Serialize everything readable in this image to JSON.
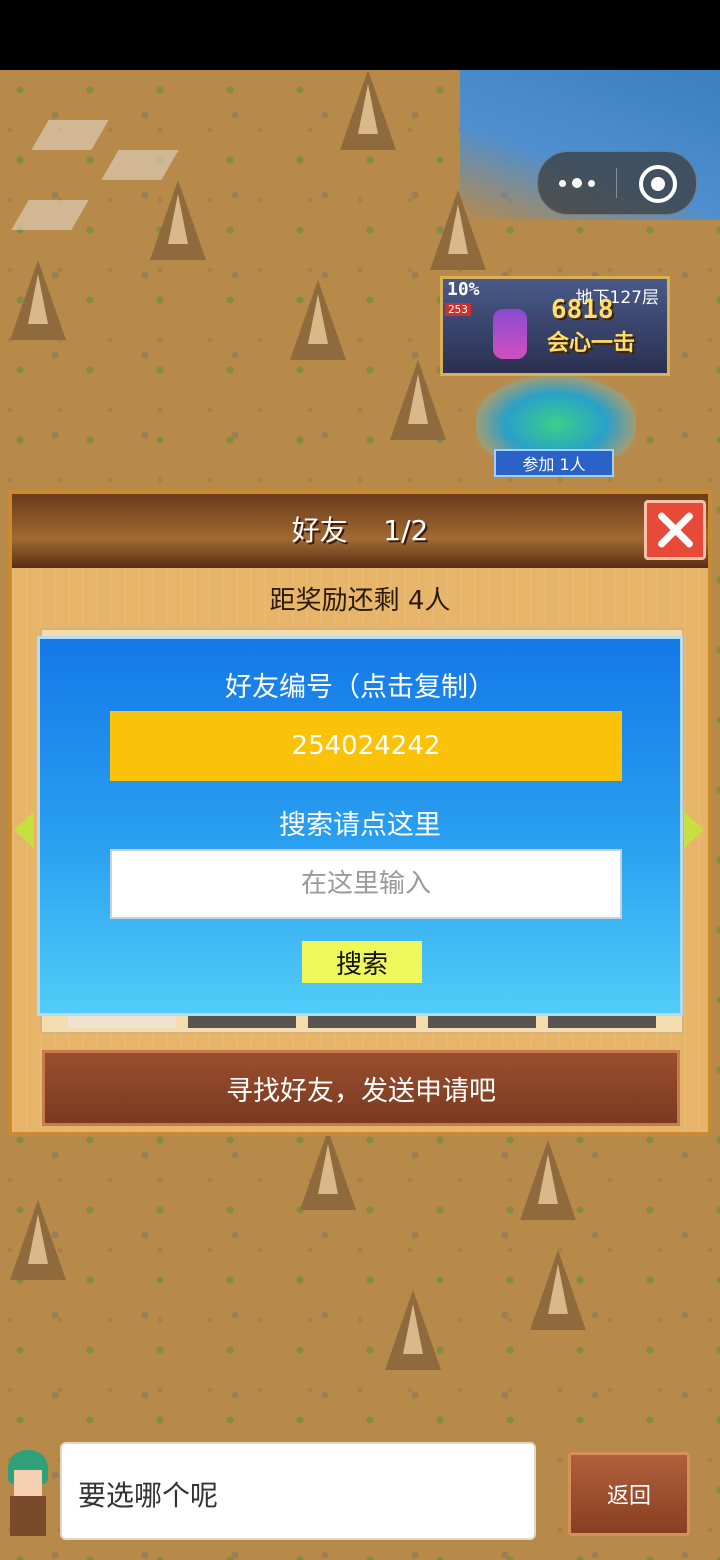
{
  "event": {
    "progress": "10%",
    "level": "253",
    "floor": "地下127层",
    "damage": "6818",
    "crit_text": "会心一击",
    "join_label": "参加 1人"
  },
  "dialog": {
    "title": "好友",
    "page": "1/2",
    "reward_text": "距奖励还剩 4人",
    "id_label": "好友编号（点击复制）",
    "friend_id": "254024242",
    "search_label": "搜索请点这里",
    "search_placeholder": "在这里输入",
    "search_button": "搜索",
    "find_button": "寻找好友，发送申请吧"
  },
  "bottom": {
    "message": "要选哪个呢",
    "back_button": "返回"
  },
  "colors": {
    "dialog_header": "#8f5a2a",
    "search_panel": "#2aa0f0",
    "id_field": "#fbc20a",
    "search_button": "#eef85a",
    "close_button": "#e84a3a"
  },
  "icons": [
    "more-icon",
    "target-icon",
    "close-icon",
    "arrow-left-icon",
    "arrow-right-icon"
  ]
}
